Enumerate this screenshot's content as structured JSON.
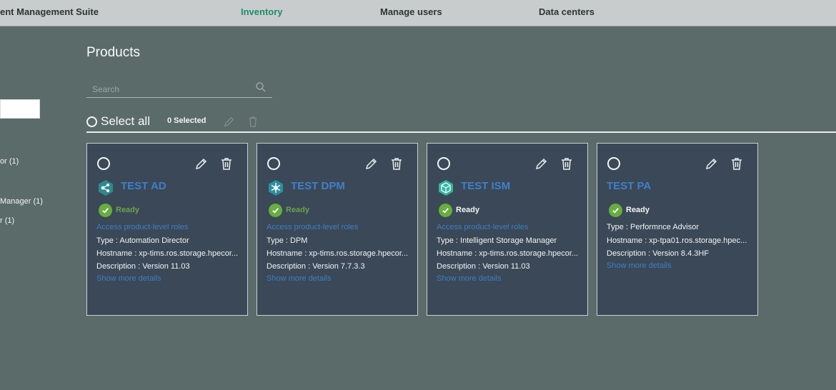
{
  "app": {
    "title": "ent Management Suite"
  },
  "nav": {
    "inventory": "Inventory",
    "manage_users": "Manage users",
    "data_centers": "Data centers"
  },
  "sidebar": {
    "items": [
      "or (1)",
      "Manager (1)",
      "r (1)"
    ]
  },
  "page": {
    "title": "Products",
    "search_placeholder": "Search"
  },
  "selection": {
    "select_all": "Select all",
    "selected": "0 Selected"
  },
  "colors": {
    "accent": "#1c8d6f",
    "card_bg": "#3b4857",
    "link": "#3d7fc4",
    "ready": "#68ad3f"
  },
  "cards": [
    {
      "name": "TEST AD",
      "icon": "automation-director-icon",
      "status": "Ready",
      "roles_link": "Access product-level roles",
      "type": "Type : Automation Director",
      "hostname": "Hostname : xp-tims.ros.storage.hpecor...",
      "description": "Description : Version 11.03",
      "more": "Show more details"
    },
    {
      "name": "TEST DPM",
      "icon": "dpm-icon",
      "status": "Ready",
      "roles_link": "Access product-level roles",
      "type": "Type : DPM",
      "hostname": "Hostname : xp-tims.ros.storage.hpecor...",
      "description": "Description : Version 7.7.3.3",
      "more": "Show more details"
    },
    {
      "name": "TEST ISM",
      "icon": "intelligent-storage-manager-icon",
      "status": "Ready",
      "roles_link": "Access product-level roles",
      "type": "Type : Intelligent Storage Manager",
      "hostname": "Hostname : xp-tims.ros.storage.hpecor...",
      "description": "Description : Version 11.03",
      "more": "Show more details"
    },
    {
      "name": "TEST PA",
      "status": "Ready",
      "type": "Type : Performnce Advisor",
      "hostname": "Hostname : xp-tpa01.ros.storage.hpec...",
      "description": "Description : Version 8.4.3HF",
      "more": "Show more details"
    }
  ]
}
